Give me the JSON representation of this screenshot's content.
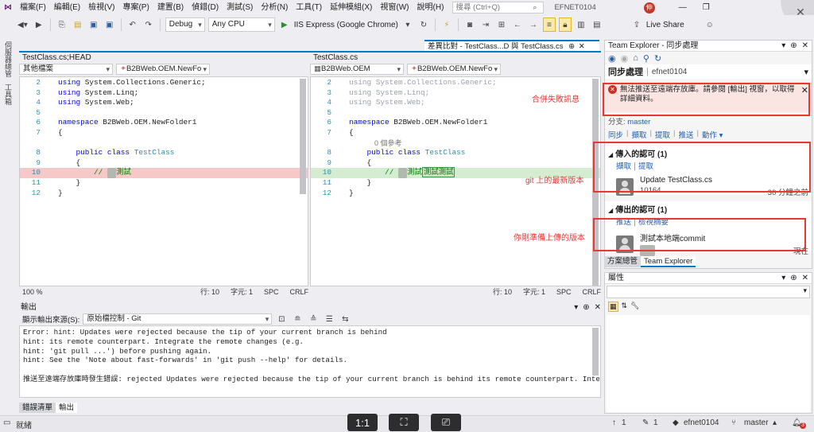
{
  "menu": [
    "檔案(F)",
    "編輯(E)",
    "檢視(V)",
    "專案(P)",
    "建置(B)",
    "偵錯(D)",
    "測試(S)",
    "分析(N)",
    "工具(T)",
    "延伸模組(X)",
    "視窗(W)",
    "說明(H)"
  ],
  "search": {
    "placeholder": "搜尋 (Ctrl+Q)"
  },
  "title_badge": "EFNET0104",
  "user_initial": "伸",
  "live_share": "Live Share",
  "toolbar": {
    "config": "Debug",
    "platform": "Any CPU",
    "run": "IIS Express (Google Chrome)"
  },
  "left_strip": [
    "伺服器總管",
    "工具箱"
  ],
  "diff_tab": "差異比對 - TestClass...D 與 TestClass.cs",
  "left_pane": {
    "title": "TestClass.cs;HEAD",
    "scope": "其他檔案",
    "member": "B2BWeb.OEM.NewFo",
    "lines": [
      {
        "n": "2",
        "code": "using System.Collections.Generic;"
      },
      {
        "n": "3",
        "code": "using System.Linq;"
      },
      {
        "n": "4",
        "code": "using System.Web;"
      },
      {
        "n": "5",
        "code": ""
      },
      {
        "n": "6",
        "code": "namespace B2BWeb.OEM.NewFolder1"
      },
      {
        "n": "7",
        "code": "{"
      },
      {
        "n": "8",
        "code": "    public class TestClass"
      },
      {
        "n": "9",
        "code": "    {"
      },
      {
        "n": "10",
        "code": "        // 測試"
      },
      {
        "n": "11",
        "code": "    }"
      },
      {
        "n": "12",
        "code": "}"
      }
    ],
    "zoom": "100 %",
    "row": "行: 10",
    "col": "字元: 1",
    "spc": "SPC",
    "crlf": "CRLF"
  },
  "right_pane": {
    "title": "TestClass.cs",
    "scope": "B2BWeb.OEM",
    "member": "B2BWeb.OEM.NewFo",
    "refs": "0 個參考",
    "row": "行: 10",
    "col": "字元: 1",
    "spc": "SPC",
    "crlf": "CRLF"
  },
  "output": {
    "title": "輸出",
    "source_label": "顯示輸出來源(S):",
    "source_value": "原始檔控制 - Git",
    "lines": [
      "Error: hint: Updates were rejected because the tip of your current branch is behind",
      "hint: its remote counterpart. Integrate the remote changes (e.g.",
      "hint: 'git pull ...') before pushing again.",
      "hint: See the 'Note about fast-forwards' in 'git push --help' for details.",
      "",
      "推送至遠端存放庫時發生錯誤: rejected Updates were rejected because the tip of your current branch is behind its remote counterpart. Integrate the remote chan"
    ],
    "tabs": [
      "錯誤清單",
      "輸出"
    ]
  },
  "team_explorer": {
    "title": "Team Explorer - 同步處理",
    "page": "同步處理",
    "repo": "efnet0104",
    "error": "無法推送至遠端存放庫。請參閱 [輸出] 視窗，以取得詳細資料。",
    "branch_label": "分支:",
    "branch": "master",
    "actions": [
      "同步",
      "擷取",
      "提取",
      "推送",
      "動作 ▾"
    ],
    "incoming_title": "傳入的認可 (1)",
    "incoming_actions": [
      "擷取",
      "提取"
    ],
    "incoming_commit": {
      "msg": "Update TestClass.cs",
      "id": "10164",
      "time": "30 分鐘之前"
    },
    "outgoing_title": "傳出的認可 (1)",
    "outgoing_actions": [
      "推送",
      "檢視摘要"
    ],
    "outgoing_commit": {
      "msg": "測試本地端commit",
      "time": "現在"
    },
    "tabs": [
      "方案總管",
      "Team Explorer"
    ]
  },
  "annotations": {
    "merge_fail": "合併失敗訊息",
    "git_latest": "git 上的最新版本",
    "local_push": "你剛準備上傳的版本"
  },
  "properties": {
    "title": "屬性"
  },
  "statusbar": {
    "ready": "就緒",
    "up": "1",
    "edits": "1",
    "repo": "efnet0104",
    "branch": "master",
    "notif": "3"
  },
  "dock": [
    "1:1"
  ]
}
